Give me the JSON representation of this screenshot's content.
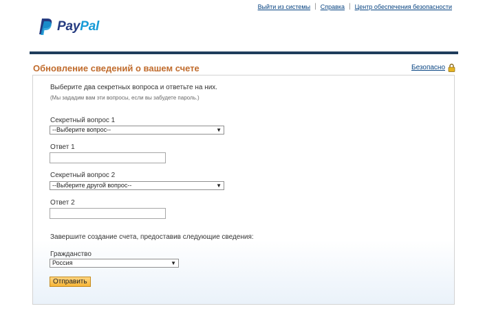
{
  "header": {
    "links": [
      "Выйти из системы",
      "Справка",
      "Центр обеспечения безопасности"
    ],
    "logo": {
      "part1": "Pay",
      "part2": "Pal",
      "icon": "paypal-logo-icon"
    }
  },
  "page": {
    "title": "Обновление сведений о вашем счете",
    "secure_link": "Безопасно",
    "secure_icon": "lock-icon"
  },
  "form": {
    "intro": "Выберите два секретных вопроса и ответьте на них.",
    "hint": "(Мы зададим вам эти вопросы, если вы забудете пароль.)",
    "question1": {
      "label": "Секретный вопрос 1",
      "value": "--Выберите вопрос--"
    },
    "answer1": {
      "label": "Ответ 1",
      "value": ""
    },
    "question2": {
      "label": "Секретный вопрос 2",
      "value": "--Выберите другой вопрос--"
    },
    "answer2": {
      "label": "Ответ 2",
      "value": ""
    },
    "complete_note": "Завершите создание счета, предоставив следующие сведения:",
    "citizenship": {
      "label": "Гражданство",
      "value": "Россия"
    },
    "submit_label": "Отправить"
  },
  "colors": {
    "title": "#c06b2c",
    "link": "#084482",
    "bar": "#1f3d5c",
    "button": "#f7b536"
  }
}
